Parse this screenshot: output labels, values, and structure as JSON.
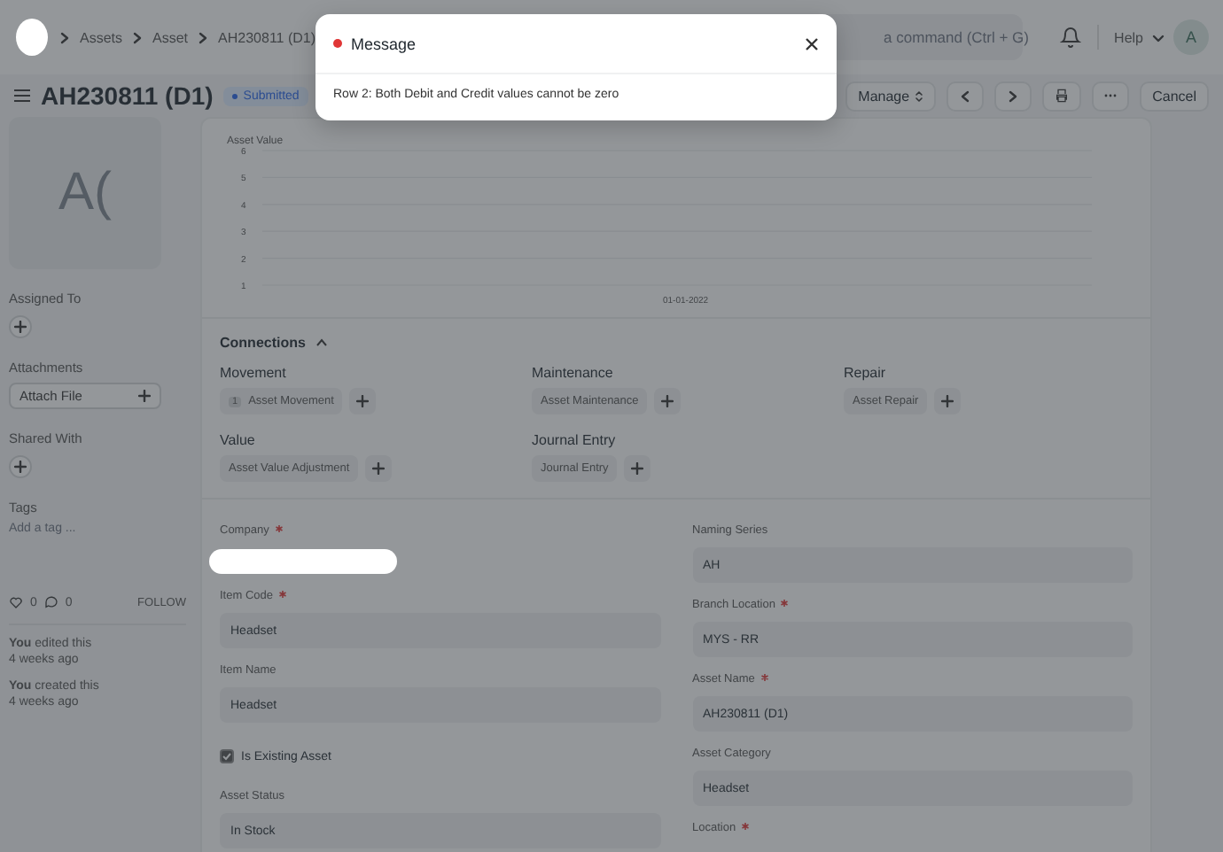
{
  "navbar": {
    "breadcrumbs": [
      "Assets",
      "Asset",
      "AH230811 (D1)"
    ],
    "search": {
      "placeholder": "a command (Ctrl + G)"
    },
    "help": "Help",
    "avatar": "A"
  },
  "header": {
    "title": "AH230811 (D1)",
    "status": "Submitted",
    "manage": "Manage",
    "cancel": "Cancel"
  },
  "sidebar": {
    "image_initials": "A(",
    "assigned_to": "Assigned To",
    "attachments": "Attachments",
    "attach_button": "Attach File",
    "shared_with": "Shared With",
    "tags": "Tags",
    "tag_placeholder": "Add a tag ...",
    "likes": "0",
    "comments": "0",
    "follow": "FOLLOW",
    "activity": [
      {
        "actor": "You",
        "text": "edited this",
        "time": "4 weeks ago"
      },
      {
        "actor": "You",
        "text": "created this",
        "time": "4 weeks ago"
      }
    ]
  },
  "chart": {
    "chart_data": {
      "type": "line",
      "title": "Asset Value",
      "categories": [
        "01-01-2022"
      ],
      "ylim": [
        1,
        6
      ],
      "yticks": [
        1,
        2,
        3,
        4,
        5,
        6
      ],
      "grid": true
    }
  },
  "connections": {
    "title": "Connections",
    "expanded": true,
    "groups": [
      {
        "label": "Movement",
        "links": [
          {
            "label": "Asset Movement",
            "count": "1"
          }
        ]
      },
      {
        "label": "Maintenance",
        "links": [
          {
            "label": "Asset Maintenance"
          }
        ]
      },
      {
        "label": "Repair",
        "links": [
          {
            "label": "Asset Repair"
          }
        ]
      },
      {
        "label": "Value",
        "links": [
          {
            "label": "Asset Value Adjustment"
          }
        ]
      },
      {
        "label": "Journal Entry",
        "links": [
          {
            "label": "Journal Entry"
          }
        ]
      }
    ]
  },
  "fields": {
    "left": [
      {
        "kind": "redacted",
        "label": "Company",
        "required": true
      },
      {
        "kind": "input",
        "label": "Item Code",
        "required": true,
        "value": "Headset"
      },
      {
        "kind": "input",
        "label": "Item Name",
        "required": false,
        "value": "Headset"
      },
      {
        "kind": "checkbox",
        "label": "Is Existing Asset",
        "checked": true
      },
      {
        "kind": "input",
        "label": "Asset Status",
        "required": false,
        "value": "In Stock"
      }
    ],
    "right": [
      {
        "kind": "input",
        "label": "Naming Series",
        "required": false,
        "value": "AH"
      },
      {
        "kind": "input",
        "label": "Branch Location",
        "required": true,
        "value": "MYS - RR"
      },
      {
        "kind": "input",
        "label": "Asset Name",
        "required": true,
        "value": "AH230811 (D1)"
      },
      {
        "kind": "input",
        "label": "Asset Category",
        "required": false,
        "value": "Headset"
      },
      {
        "kind": "label",
        "label": "Location",
        "required": true
      }
    ]
  },
  "modal": {
    "title": "Message",
    "color": "#e03636",
    "body": "Row 2: Both Debit and Credit values cannot be zero"
  }
}
